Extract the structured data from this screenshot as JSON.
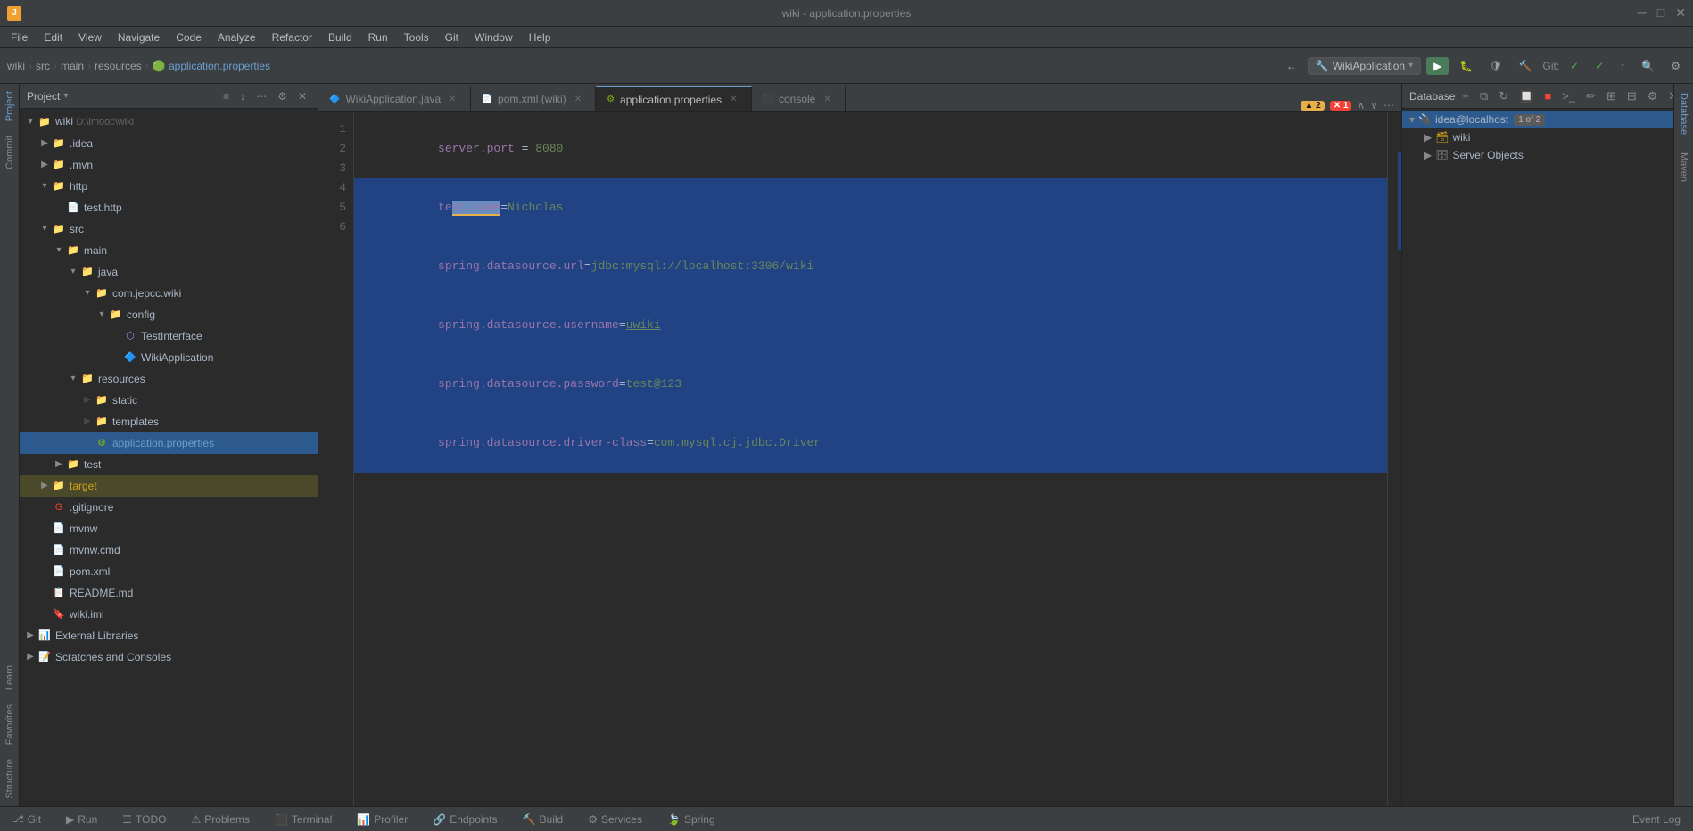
{
  "titlebar": {
    "title": "wiki - application.properties",
    "minimize": "─",
    "maximize": "□",
    "close": "✕"
  },
  "menubar": {
    "items": [
      "File",
      "Edit",
      "View",
      "Navigate",
      "Code",
      "Analyze",
      "Refactor",
      "Build",
      "Run",
      "Tools",
      "Git",
      "Window",
      "Help"
    ]
  },
  "toolbar": {
    "breadcrumbs": [
      "wiki",
      "src",
      "main",
      "resources",
      "application.properties"
    ],
    "run_config": "WikiApplication",
    "git_label": "Git:"
  },
  "project_panel": {
    "title": "Project",
    "dropdown_arrow": "▾",
    "tree": [
      {
        "id": "wiki",
        "label": "wiki",
        "path": "D:\\imooc\\wiki",
        "indent": 0,
        "type": "root",
        "expanded": true,
        "arrow": "▾"
      },
      {
        "id": "idea",
        "label": ".idea",
        "indent": 1,
        "type": "folder",
        "expanded": false,
        "arrow": "▶"
      },
      {
        "id": "mvn",
        "label": ".mvn",
        "indent": 1,
        "type": "folder",
        "expanded": false,
        "arrow": "▶"
      },
      {
        "id": "http",
        "label": "http",
        "indent": 1,
        "type": "folder",
        "expanded": true,
        "arrow": "▾"
      },
      {
        "id": "test-http",
        "label": "test.http",
        "indent": 2,
        "type": "file-http"
      },
      {
        "id": "src",
        "label": "src",
        "indent": 1,
        "type": "folder",
        "expanded": true,
        "arrow": "▾"
      },
      {
        "id": "main",
        "label": "main",
        "indent": 2,
        "type": "folder",
        "expanded": true,
        "arrow": "▾"
      },
      {
        "id": "java",
        "label": "java",
        "indent": 3,
        "type": "folder",
        "expanded": true,
        "arrow": "▾"
      },
      {
        "id": "com.jepcc.wiki",
        "label": "com.jepcc.wiki",
        "indent": 4,
        "type": "folder",
        "expanded": true,
        "arrow": "▾"
      },
      {
        "id": "config",
        "label": "config",
        "indent": 5,
        "type": "folder",
        "expanded": true,
        "arrow": "▾"
      },
      {
        "id": "TestInterface",
        "label": "TestInterface",
        "indent": 6,
        "type": "java-interface"
      },
      {
        "id": "WikiApplication",
        "label": "WikiApplication",
        "indent": 6,
        "type": "java-class"
      },
      {
        "id": "resources",
        "label": "resources",
        "indent": 3,
        "type": "folder",
        "expanded": true,
        "arrow": "▾"
      },
      {
        "id": "static",
        "label": "static",
        "indent": 4,
        "type": "folder",
        "expanded": false
      },
      {
        "id": "templates",
        "label": "templates",
        "indent": 4,
        "type": "folder",
        "expanded": false
      },
      {
        "id": "application.properties",
        "label": "application.properties",
        "indent": 4,
        "type": "props",
        "selected": true
      },
      {
        "id": "test",
        "label": "test",
        "indent": 2,
        "type": "folder",
        "expanded": false,
        "arrow": "▶"
      },
      {
        "id": "target",
        "label": "target",
        "indent": 1,
        "type": "folder-yellow",
        "expanded": false,
        "arrow": "▶"
      },
      {
        "id": "gitignore",
        "label": ".gitignore",
        "indent": 1,
        "type": "file-git"
      },
      {
        "id": "mvnw",
        "label": "mvnw",
        "indent": 1,
        "type": "file"
      },
      {
        "id": "mvnw-cmd",
        "label": "mvnw.cmd",
        "indent": 1,
        "type": "file"
      },
      {
        "id": "pom-xml",
        "label": "pom.xml",
        "indent": 1,
        "type": "xml"
      },
      {
        "id": "README",
        "label": "README.md",
        "indent": 1,
        "type": "markdown"
      },
      {
        "id": "wiki-iml",
        "label": "wiki.iml",
        "indent": 1,
        "type": "iml"
      },
      {
        "id": "external-libs",
        "label": "External Libraries",
        "indent": 0,
        "type": "ext-libs",
        "expanded": false,
        "arrow": "▶"
      },
      {
        "id": "scratches",
        "label": "Scratches and Consoles",
        "indent": 0,
        "type": "scratches",
        "expanded": false,
        "arrow": "▶"
      }
    ]
  },
  "editor": {
    "tabs": [
      {
        "label": "WikiApplication.java",
        "type": "java",
        "active": false,
        "closable": true
      },
      {
        "label": "pom.xml (wiki)",
        "type": "xml",
        "active": false,
        "closable": true
      },
      {
        "label": "application.properties",
        "type": "props",
        "active": true,
        "closable": true
      },
      {
        "label": "console",
        "type": "console",
        "active": false,
        "closable": true
      }
    ],
    "lines": [
      {
        "num": 1,
        "content": "server.port = 8080",
        "highlighted": false
      },
      {
        "num": 2,
        "content": "test.name=Nicholas",
        "highlighted": true
      },
      {
        "num": 3,
        "content": "spring.datasource.url=jdbc:mysql://localhost:3306/wiki",
        "highlighted": true
      },
      {
        "num": 4,
        "content": "spring.datasource.username=uwiki",
        "highlighted": true
      },
      {
        "num": 5,
        "content": "spring.datasource.password=test@123",
        "highlighted": true
      },
      {
        "num": 6,
        "content": "spring.datasource.driver-class=com.mysql.cj.jdbc.Driver",
        "highlighted": true
      }
    ],
    "warnings": 2,
    "errors": 1
  },
  "database": {
    "panel_title": "Database",
    "connection": {
      "label": "idea@localhost",
      "badge": "1 of 2",
      "expanded": true
    },
    "items": [
      {
        "label": "wiki",
        "type": "db",
        "indent": 1,
        "expanded": true,
        "arrow": "▶"
      },
      {
        "label": "Server Objects",
        "type": "server",
        "indent": 1,
        "expanded": false,
        "arrow": "▶"
      }
    ]
  },
  "statusbar": {
    "items": [
      "Git",
      "Run",
      "TODO",
      "Problems",
      "Terminal",
      "Profiler",
      "Endpoints",
      "Build",
      "Services",
      "Spring"
    ],
    "event_log": "Event Log"
  },
  "vertical_tabs": {
    "left": [
      "Project",
      "Commit",
      "Learn"
    ],
    "right": [
      "Database",
      "Maven"
    ]
  }
}
